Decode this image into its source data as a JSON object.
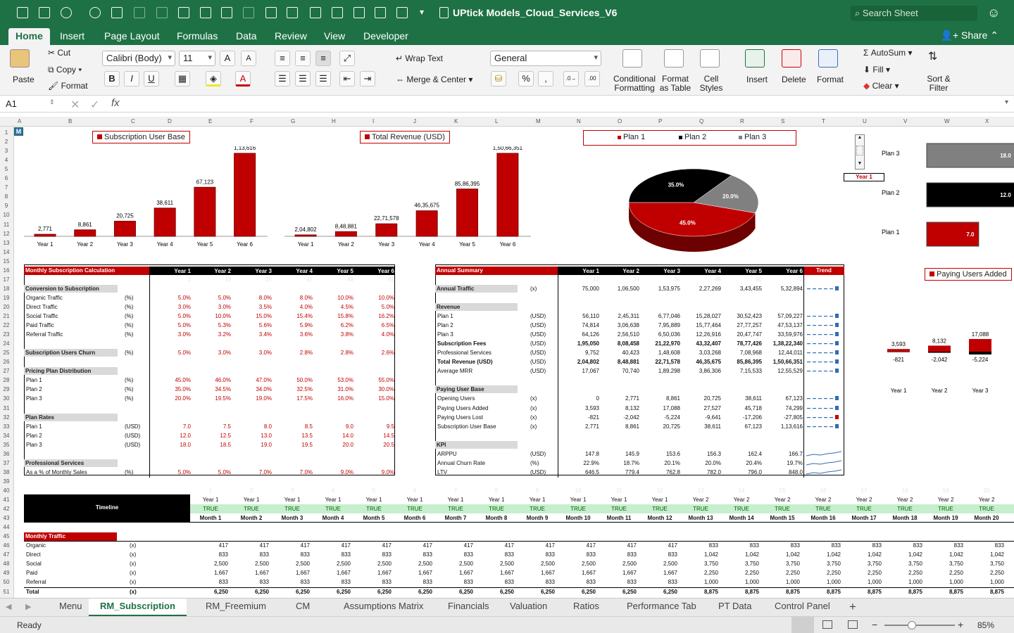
{
  "title": "UPtick Models_Cloud_Services_V6",
  "search_placeholder": "Search Sheet",
  "tabs": [
    "Home",
    "Insert",
    "Page Layout",
    "Formulas",
    "Data",
    "Review",
    "View",
    "Developer"
  ],
  "share": "Share",
  "ribbon": {
    "paste": "Paste",
    "cut": "Cut",
    "copy": "Copy",
    "format": "Format",
    "font": "Calibri (Body)",
    "size": "11",
    "wrap": "Wrap Text",
    "merge": "Merge & Center",
    "numfmt": "General",
    "cond1": "Conditional",
    "cond2": "Formatting",
    "fmt1": "Format",
    "fmt2": "as Table",
    "cell1": "Cell",
    "cell2": "Styles",
    "insert": "Insert",
    "delete": "Delete",
    "format2": "Format",
    "autosum": "AutoSum",
    "fill": "Fill",
    "clear": "Clear",
    "sort1": "Sort &",
    "sort2": "Filter",
    "bold": "B",
    "italic": "I",
    "underline": "U",
    "percent": "%"
  },
  "namebox": "A1",
  "fx": "fx",
  "columns": [
    "A",
    "B",
    "C",
    "D",
    "E",
    "F",
    "G",
    "H",
    "I",
    "J",
    "K",
    "L",
    "M",
    "N",
    "O",
    "P",
    "Q",
    "R",
    "S",
    "T",
    "U",
    "V",
    "W",
    "X"
  ],
  "colors": {
    "accent": "#1e7145",
    "red": "#c00000",
    "black": "#000000",
    "grey": "#808080"
  },
  "chart_data": [
    {
      "type": "bar",
      "title": "Subscription User Base",
      "categories": [
        "Year 1",
        "Year 2",
        "Year 3",
        "Year 4",
        "Year 5",
        "Year 6"
      ],
      "values": [
        2771,
        8861,
        20725,
        38611,
        67123,
        113616
      ],
      "labels": [
        "2,771",
        "8,861",
        "20,725",
        "38,611",
        "67,123",
        "1,13,616"
      ]
    },
    {
      "type": "bar",
      "title": "Total Revenue (USD)",
      "categories": [
        "Year 1",
        "Year 2",
        "Year 3",
        "Year 4",
        "Year 5",
        "Year 6"
      ],
      "values": [
        204802,
        848881,
        2271578,
        4635675,
        8586395,
        15066351
      ],
      "labels": [
        "2,04,802",
        "8,48,881",
        "22,71,578",
        "46,35,675",
        "85,86,395",
        "1,50,66,351"
      ]
    },
    {
      "type": "pie",
      "legend": [
        "Plan 1",
        "Plan 2",
        "Plan 3"
      ],
      "values": [
        45.0,
        35.0,
        20.0
      ],
      "labels": [
        "45.0%",
        "35.0%",
        "20.0%"
      ],
      "colors": [
        "#c00000",
        "#000000",
        "#808080"
      ]
    },
    {
      "type": "bar",
      "orientation": "horizontal",
      "categories": [
        "Plan 3",
        "Plan 2",
        "Plan 1"
      ],
      "values": [
        18.0,
        12.0,
        7.0
      ],
      "labels": [
        "18.0",
        "12.0",
        "7.0"
      ],
      "selector": "Year 1"
    },
    {
      "type": "bar",
      "title": "Paying Users Added",
      "categories": [
        "Year 1",
        "Year 2",
        "Year 3"
      ],
      "positive": [
        3593,
        8132,
        17088
      ],
      "negative": [
        -821,
        -2042,
        -5224
      ],
      "pos_labels": [
        "3,593",
        "8,132",
        "17,088"
      ],
      "neg_labels": [
        "-821",
        "-2,042",
        "-5,224"
      ]
    }
  ],
  "left_table": {
    "title": "Monthly Subscription Calculation",
    "years": [
      "Year 1",
      "Year 2",
      "Year 3",
      "Year 4",
      "Year 5",
      "Year 6"
    ],
    "faint": [
      "1",
      "13",
      "25",
      "37",
      "49",
      "61"
    ],
    "rows": [
      {
        "row": 17,
        "label": "",
        "unit": "",
        "vals": []
      },
      {
        "row": 18,
        "label": "Conversion to Subscription",
        "unit": "",
        "vals": [],
        "section": true
      },
      {
        "row": 19,
        "label": "Organic Traffic",
        "unit": "(%)",
        "vals": [
          "5.0%",
          "5.0%",
          "8.0%",
          "8.0%",
          "10.0%",
          "10.0%"
        ]
      },
      {
        "row": 20,
        "label": "Direct Traffic",
        "unit": "(%)",
        "vals": [
          "3.0%",
          "3.0%",
          "3.5%",
          "4.0%",
          "4.5%",
          "5.0%"
        ]
      },
      {
        "row": 21,
        "label": "Social Traffic",
        "unit": "(%)",
        "vals": [
          "5.0%",
          "10.0%",
          "15.0%",
          "15.4%",
          "15.8%",
          "16.2%"
        ]
      },
      {
        "row": 22,
        "label": "Paid Traffic",
        "unit": "(%)",
        "vals": [
          "5.0%",
          "5.3%",
          "5.6%",
          "5.9%",
          "6.2%",
          "6.5%"
        ]
      },
      {
        "row": 23,
        "label": "Referral Traffic",
        "unit": "(%)",
        "vals": [
          "3.0%",
          "3.2%",
          "3.4%",
          "3.6%",
          "3.8%",
          "4.0%"
        ]
      },
      {
        "row": 25,
        "label": "Subscription Users Churn",
        "unit": "(%)",
        "vals": [
          "5.0%",
          "3.0%",
          "3.0%",
          "2.8%",
          "2.8%",
          "2.6%"
        ],
        "section": true
      },
      {
        "row": 27,
        "label": "Pricing Plan Distribution",
        "unit": "",
        "vals": [],
        "section": true
      },
      {
        "row": 28,
        "label": "Plan 1",
        "unit": "(%)",
        "vals": [
          "45.0%",
          "46.0%",
          "47.0%",
          "50.0%",
          "53.0%",
          "55.0%"
        ]
      },
      {
        "row": 29,
        "label": "Plan 2",
        "unit": "(%)",
        "vals": [
          "35.0%",
          "34.5%",
          "34.0%",
          "32.5%",
          "31.0%",
          "30.0%"
        ]
      },
      {
        "row": 30,
        "label": "Plan 3",
        "unit": "(%)",
        "vals": [
          "20.0%",
          "19.5%",
          "19.0%",
          "17.5%",
          "16.0%",
          "15.0%"
        ]
      },
      {
        "row": 32,
        "label": "Plan Rates",
        "unit": "",
        "vals": [],
        "section": true
      },
      {
        "row": 33,
        "label": "Plan 1",
        "unit": "(USD)",
        "vals": [
          "7.0",
          "7.5",
          "8.0",
          "8.5",
          "9.0",
          "9.5"
        ]
      },
      {
        "row": 34,
        "label": "Plan 2",
        "unit": "(USD)",
        "vals": [
          "12.0",
          "12.5",
          "13.0",
          "13.5",
          "14.0",
          "14.5"
        ]
      },
      {
        "row": 35,
        "label": "Plan 3",
        "unit": "(USD)",
        "vals": [
          "18.0",
          "18.5",
          "19.0",
          "19.5",
          "20.0",
          "20.5"
        ]
      },
      {
        "row": 37,
        "label": "Professional Services",
        "unit": "",
        "vals": [],
        "section": true
      },
      {
        "row": 38,
        "label": "As a % of Monthly Sales",
        "unit": "(%)",
        "vals": [
          "5.0%",
          "5.0%",
          "7.0%",
          "7.0%",
          "9.0%",
          "9.0%"
        ]
      }
    ]
  },
  "right_table": {
    "title": "Annual Summary",
    "years": [
      "Year 1",
      "Year 2",
      "Year 3",
      "Year 4",
      "Year 5",
      "Year 6"
    ],
    "trend": "Trend",
    "faint": [
      "12",
      "24",
      "36",
      "48",
      "60",
      "72"
    ],
    "rows": [
      {
        "row": 18,
        "label": "Annual Traffic",
        "unit": "(x)",
        "vals": [
          "75,000",
          "1,06,500",
          "1,53,975",
          "2,27,269",
          "3,43,455",
          "5,32,894"
        ],
        "section": true,
        "spark": "bars"
      },
      {
        "row": 20,
        "label": "Revenue",
        "unit": "",
        "vals": [],
        "section": true
      },
      {
        "row": 21,
        "label": "Plan 1",
        "unit": "(USD)",
        "vals": [
          "56,110",
          "2,45,311",
          "6,77,046",
          "15,28,027",
          "30,52,423",
          "57,09,227"
        ],
        "spark": "bars"
      },
      {
        "row": 22,
        "label": "Plan 2",
        "unit": "(USD)",
        "vals": [
          "74,814",
          "3,06,638",
          "7,95,889",
          "15,77,464",
          "27,77,257",
          "47,53,137"
        ],
        "spark": "bars"
      },
      {
        "row": 23,
        "label": "Plan 3",
        "unit": "(USD)",
        "vals": [
          "64,126",
          "2,56,510",
          "6,50,036",
          "12,26,916",
          "20,47,747",
          "33,59,976"
        ],
        "spark": "bars"
      },
      {
        "row": 24,
        "label": "Subscription Fees",
        "unit": "(USD)",
        "vals": [
          "1,95,050",
          "8,08,458",
          "21,22,970",
          "43,32,407",
          "78,77,426",
          "1,38,22,340"
        ],
        "bold": true,
        "spark": "bars"
      },
      {
        "row": 25,
        "label": "Professional Services",
        "unit": "(USD)",
        "vals": [
          "9,752",
          "40,423",
          "1,48,608",
          "3,03,268",
          "7,08,968",
          "12,44,011"
        ],
        "spark": "bars"
      },
      {
        "row": 26,
        "label": "Total Revenue (USD)",
        "unit": "(USD)",
        "vals": [
          "2,04,802",
          "8,48,881",
          "22,71,578",
          "46,35,675",
          "85,86,395",
          "1,50,66,351"
        ],
        "bold": true,
        "spark": "bars"
      },
      {
        "row": 27,
        "label": "Average MRR",
        "unit": "(USD)",
        "vals": [
          "17,067",
          "70,740",
          "1,89,298",
          "3,86,306",
          "7,15,533",
          "12,55,529"
        ],
        "spark": "bars"
      },
      {
        "row": 29,
        "label": "Paying User Base",
        "unit": "",
        "vals": [],
        "section": true
      },
      {
        "row": 30,
        "label": "Opening Users",
        "unit": "(x)",
        "vals": [
          "0",
          "2,771",
          "8,861",
          "20,725",
          "38,611",
          "67,123"
        ],
        "spark": "bars"
      },
      {
        "row": 31,
        "label": "Paying Users Added",
        "unit": "(x)",
        "vals": [
          "3,593",
          "8,132",
          "17,088",
          "27,527",
          "45,718",
          "74,299"
        ],
        "spark": "bars"
      },
      {
        "row": 32,
        "label": "Paying Users Lost",
        "unit": "(x)",
        "vals": [
          "-821",
          "-2,042",
          "-5,224",
          "-9,641",
          "-17,206",
          "-27,805"
        ],
        "spark": "redbars"
      },
      {
        "row": 33,
        "label": "Subscription User Base",
        "unit": "(x)",
        "vals": [
          "2,771",
          "8,861",
          "20,725",
          "38,611",
          "67,123",
          "1,13,616"
        ],
        "spark": "bars"
      },
      {
        "row": 35,
        "label": "KPI",
        "unit": "",
        "vals": [],
        "section": true
      },
      {
        "row": 36,
        "label": "ARPPU",
        "unit": "(USD)",
        "vals": [
          "147.8",
          "145.9",
          "153.6",
          "156.3",
          "162.4",
          "166.7"
        ],
        "spark": "line"
      },
      {
        "row": 37,
        "label": "Annual Churn Rate",
        "unit": "(%)",
        "vals": [
          "22.9%",
          "18.7%",
          "20.1%",
          "20.0%",
          "20.4%",
          "19.7%"
        ],
        "spark": "line"
      },
      {
        "row": 38,
        "label": "LTV",
        "unit": "(USD)",
        "vals": [
          "646.5",
          "779.4",
          "762.8",
          "782.0",
          "796.0",
          "848.0"
        ],
        "spark": "line"
      }
    ]
  },
  "timeline": {
    "label": "Timeline",
    "row40": [
      "1",
      "2",
      "3",
      "4",
      "5",
      "6",
      "7",
      "8",
      "9",
      "10",
      "11",
      "12",
      "13",
      "14",
      "15",
      "16",
      "17",
      "18",
      "19",
      "20"
    ],
    "years": [
      "Year 1",
      "Year 1",
      "Year 1",
      "Year 1",
      "Year 1",
      "Year 1",
      "Year 1",
      "Year 1",
      "Year 1",
      "Year 1",
      "Year 1",
      "Year 1",
      "Year 2",
      "Year 2",
      "Year 2",
      "Year 2",
      "Year 2",
      "Year 2",
      "Year 2",
      "Year 2"
    ],
    "flags": [
      "TRUE",
      "TRUE",
      "TRUE",
      "TRUE",
      "TRUE",
      "TRUE",
      "TRUE",
      "TRUE",
      "TRUE",
      "TRUE",
      "TRUE",
      "TRUE",
      "TRUE",
      "TRUE",
      "TRUE",
      "TRUE",
      "TRUE",
      "TRUE",
      "TRUE",
      "TRUE"
    ],
    "months": [
      "Month 1",
      "Month 2",
      "Month 3",
      "Month 4",
      "Month 5",
      "Month 6",
      "Month 7",
      "Month 8",
      "Month 9",
      "Month 10",
      "Month 11",
      "Month 12",
      "Month 13",
      "Month 14",
      "Month 15",
      "Month 16",
      "Month 17",
      "Month 18",
      "Month 19",
      "Month 20"
    ]
  },
  "traffic": {
    "title": "Monthly Traffic",
    "rows": [
      {
        "row": 46,
        "label": "Organic",
        "unit": "(x)",
        "vals": [
          "417",
          "417",
          "417",
          "417",
          "417",
          "417",
          "417",
          "417",
          "417",
          "417",
          "417",
          "417",
          "833",
          "833",
          "833",
          "833",
          "833",
          "833",
          "833",
          "833"
        ]
      },
      {
        "row": 47,
        "label": "Direct",
        "unit": "(x)",
        "vals": [
          "833",
          "833",
          "833",
          "833",
          "833",
          "833",
          "833",
          "833",
          "833",
          "833",
          "833",
          "833",
          "1,042",
          "1,042",
          "1,042",
          "1,042",
          "1,042",
          "1,042",
          "1,042",
          "1,042"
        ]
      },
      {
        "row": 48,
        "label": "Social",
        "unit": "(x)",
        "vals": [
          "2,500",
          "2,500",
          "2,500",
          "2,500",
          "2,500",
          "2,500",
          "2,500",
          "2,500",
          "2,500",
          "2,500",
          "2,500",
          "2,500",
          "3,750",
          "3,750",
          "3,750",
          "3,750",
          "3,750",
          "3,750",
          "3,750",
          "3,750"
        ]
      },
      {
        "row": 49,
        "label": "Paid",
        "unit": "(x)",
        "vals": [
          "1,667",
          "1,667",
          "1,667",
          "1,667",
          "1,667",
          "1,667",
          "1,667",
          "1,667",
          "1,667",
          "1,667",
          "1,667",
          "1,667",
          "2,250",
          "2,250",
          "2,250",
          "2,250",
          "2,250",
          "2,250",
          "2,250",
          "2,250"
        ]
      },
      {
        "row": 50,
        "label": "Referral",
        "unit": "(x)",
        "vals": [
          "833",
          "833",
          "833",
          "833",
          "833",
          "833",
          "833",
          "833",
          "833",
          "833",
          "833",
          "833",
          "1,000",
          "1,000",
          "1,000",
          "1,000",
          "1,000",
          "1,000",
          "1,000",
          "1,000"
        ]
      },
      {
        "row": 51,
        "label": "Total",
        "unit": "(x)",
        "vals": [
          "6,250",
          "6,250",
          "6,250",
          "6,250",
          "6,250",
          "6,250",
          "6,250",
          "6,250",
          "6,250",
          "6,250",
          "6,250",
          "6,250",
          "8,875",
          "8,875",
          "8,875",
          "8,875",
          "8,875",
          "8,875",
          "8,875",
          "8,875"
        ],
        "bold": true
      }
    ]
  },
  "sheets": [
    "Menu",
    "RM_Subscription",
    "RM_Freemium",
    "CM",
    "Assumptions Matrix",
    "Financials",
    "Valuation",
    "Ratios",
    "Performance Tab",
    "PT Data",
    "Control Panel"
  ],
  "active_sheet": "RM_Subscription",
  "status": "Ready",
  "zoom": "85%"
}
